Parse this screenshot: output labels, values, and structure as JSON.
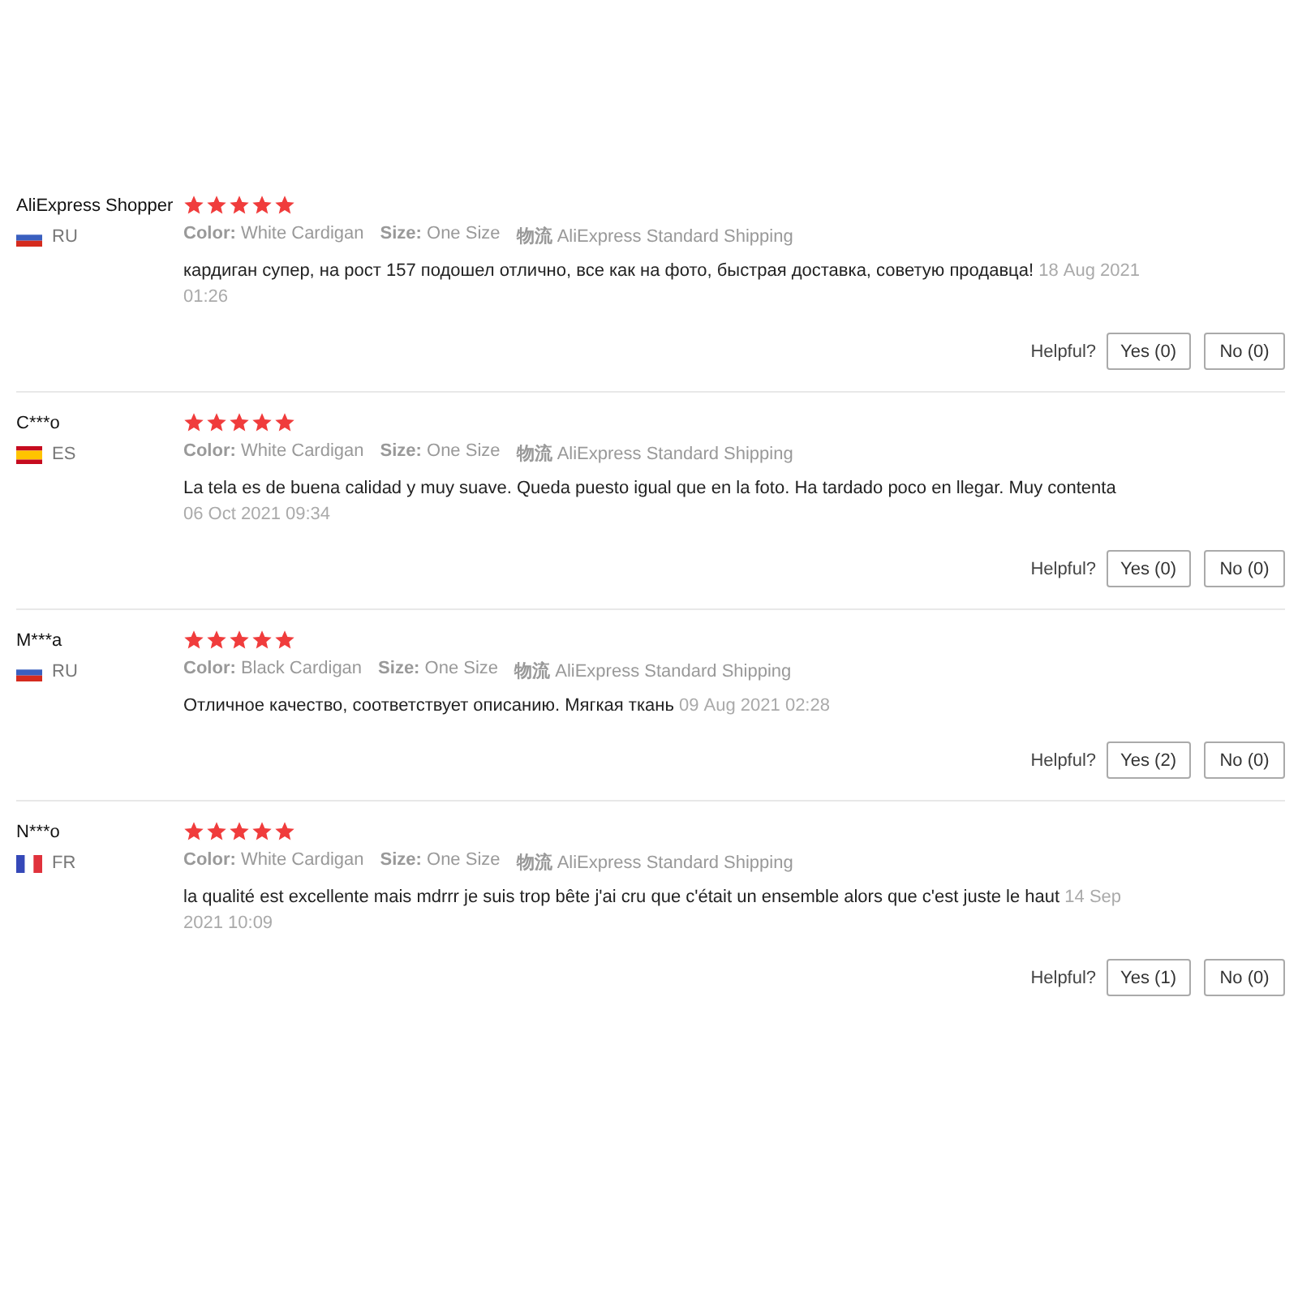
{
  "reviews": [
    {
      "author": "AliExpress Shopper",
      "country": "RU",
      "flag": {
        "kind": "russia"
      },
      "stars": 5,
      "attributes": [
        "**Color:** White Cardigan",
        "**Size:** One Size",
        "**物流** AliExpress Standard Shipping"
      ],
      "text": "кардиган супер, на рост 157 подошел отлично, все как на фото, быстрая доставка, советую продавца!",
      "date": "18 Aug 2021 01:26",
      "helpful_label": "Helpful?",
      "yes": "Yes (0)",
      "no": "No (0)"
    },
    {
      "author": "C***o",
      "country": "ES",
      "flag": {
        "kind": "spain"
      },
      "stars": 5,
      "attributes": [
        "**Color:** White Cardigan",
        "**Size:** One Size",
        "**物流** AliExpress Standard Shipping"
      ],
      "text": "La tela es de buena calidad y muy suave. Queda puesto igual que en la foto. Ha tardado poco en llegar. Muy contenta",
      "date": "06 Oct 2021 09:34",
      "helpful_label": "Helpful?",
      "yes": "Yes (0)",
      "no": "No (0)"
    },
    {
      "author": "M***a",
      "country": "RU",
      "flag": {
        "kind": "russia"
      },
      "stars": 5,
      "attributes": [
        "**Color:** Black Cardigan",
        "**Size:** One Size",
        "**物流** AliExpress Standard Shipping"
      ],
      "text": "Отличное качество, соответствует описанию. Мягкая ткань",
      "date": "09 Aug 2021 02:28",
      "helpful_label": "Helpful?",
      "yes": "Yes (2)",
      "no": "No (0)"
    },
    {
      "author": "N***o",
      "country": "FR",
      "flag": {
        "kind": "france"
      },
      "stars": 5,
      "attributes": [
        "**Color:** White Cardigan",
        "**Size:** One Size",
        "**物流** AliExpress Standard Shipping"
      ],
      "text": "la qualité est excellente mais mdrrr je suis trop bête j'ai cru que c'était un ensemble alors que c'est juste le haut",
      "date": "14 Sep 2021 10:09",
      "helpful_label": "Helpful?",
      "yes": "Yes (1)",
      "no": "No (0)"
    }
  ]
}
